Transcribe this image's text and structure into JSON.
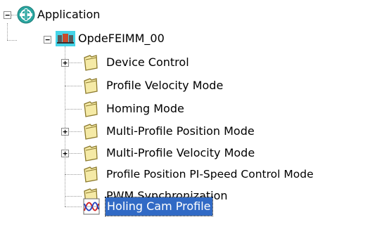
{
  "tree": {
    "root": {
      "label": "Application",
      "expander": "−",
      "icon": "application-icon"
    },
    "node": {
      "label": "OpdeFEIMM_00",
      "expander": "−",
      "icon": "device-node-icon"
    },
    "children": [
      {
        "label": "Device Control",
        "expander": "+",
        "icon": "folder-icon"
      },
      {
        "label": "Profile Velocity Mode",
        "expander": "",
        "icon": "folder-icon"
      },
      {
        "label": "Homing Mode",
        "expander": "",
        "icon": "folder-icon"
      },
      {
        "label": "Multi-Profile Position Mode",
        "expander": "+",
        "icon": "folder-icon"
      },
      {
        "label": "Multi-Profile Velocity Mode",
        "expander": "+",
        "icon": "folder-icon"
      },
      {
        "label": "Profile Position PI-Speed Control Mode",
        "expander": "",
        "icon": "folder-icon"
      },
      {
        "label": "PWM Synchronization",
        "expander": "",
        "icon": "folder-icon"
      },
      {
        "label": "Holing Cam Profile",
        "expander": "",
        "icon": "cam-profile-icon",
        "selected": true
      }
    ]
  },
  "colors": {
    "selection": "#316ac5",
    "folder_fill": "#f5eaa6",
    "folder_stroke": "#8c7a2e",
    "app_icon": "#2aa6a0"
  }
}
